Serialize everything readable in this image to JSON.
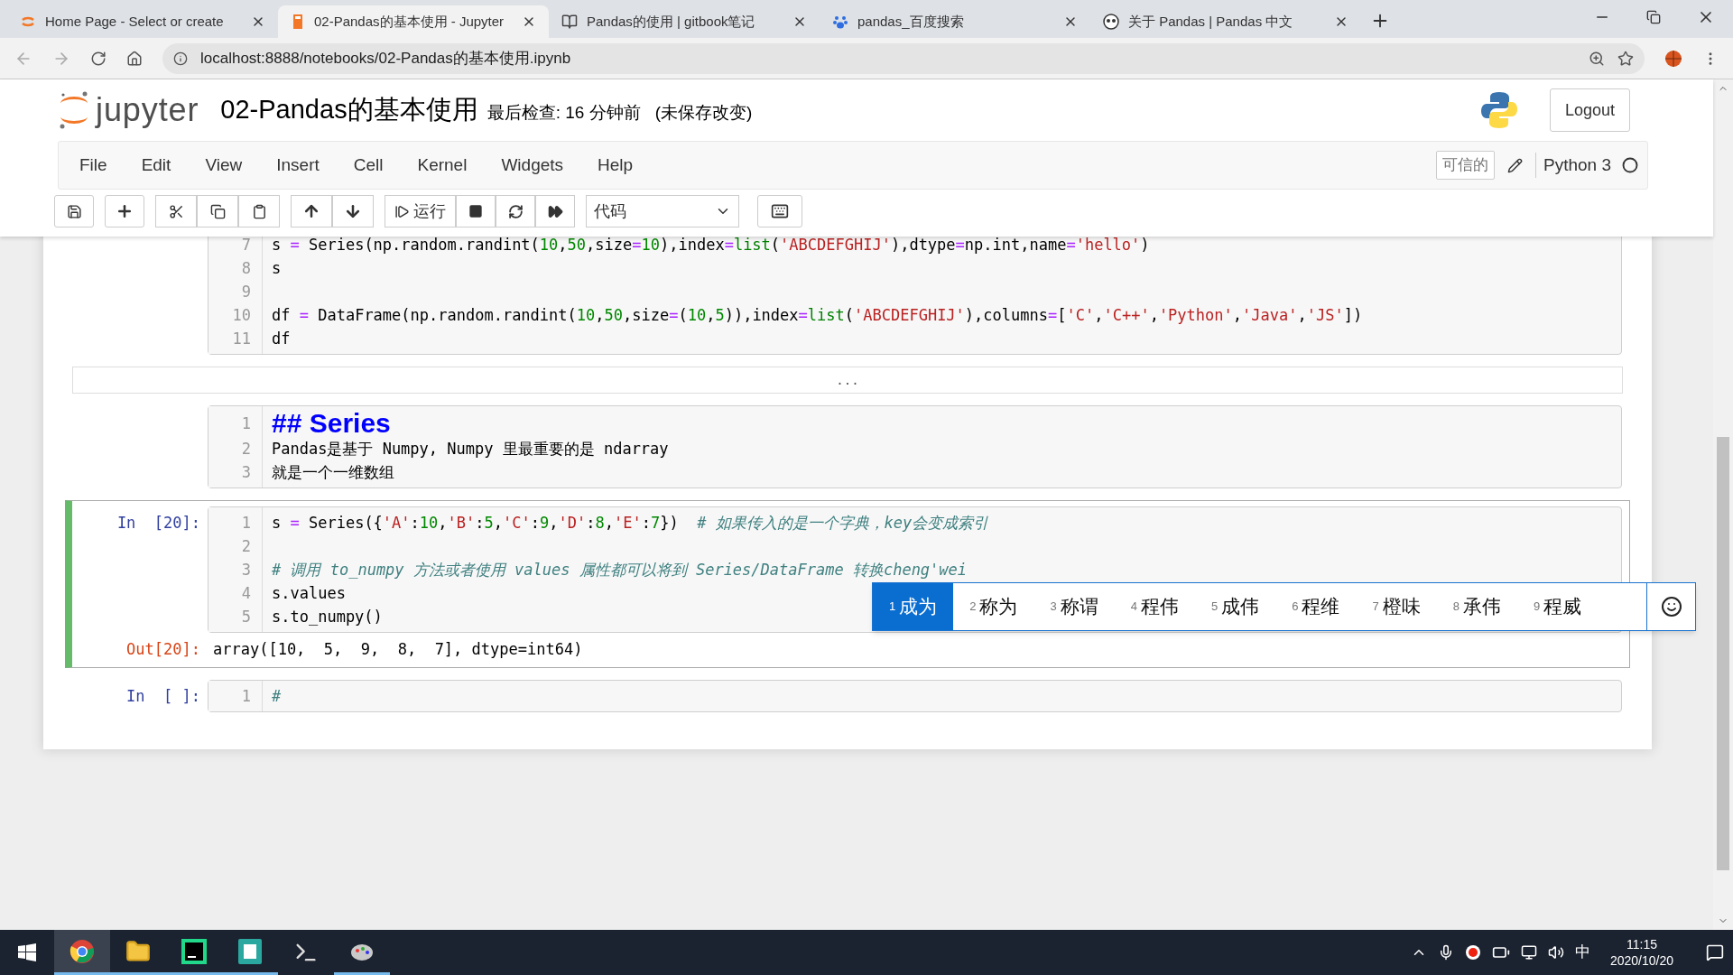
{
  "browser": {
    "tabs": [
      {
        "title": "Home Page - Select or create",
        "selected": false
      },
      {
        "title": "02-Pandas的基本使用 - Jupyter",
        "selected": true
      },
      {
        "title": "Pandas的使用 | gitbook笔记",
        "selected": false
      },
      {
        "title": "pandas_百度搜索",
        "selected": false
      },
      {
        "title": "关于 Pandas | Pandas 中文",
        "selected": false
      }
    ],
    "address": "localhost:8888/notebooks/02-Pandas的基本使用.ipynb"
  },
  "header": {
    "logo_text": "jupyter",
    "title": "02-Pandas的基本使用",
    "checkpoint": "最后检查: 16 分钟前",
    "unsaved": "(未保存改变)",
    "logout": "Logout"
  },
  "menu": [
    "File",
    "Edit",
    "View",
    "Insert",
    "Cell",
    "Kernel",
    "Widgets",
    "Help"
  ],
  "status": {
    "trusted": "可信的",
    "kernel": "Python 3"
  },
  "toolbar": {
    "run": "运行",
    "cell_type": "代码"
  },
  "cells": [
    {
      "kind": "code",
      "selected": false,
      "lines": [
        {
          "number": "7",
          "segments": [
            {
              "text": "s ",
              "kind": "plain"
            },
            {
              "text": "=",
              "kind": "op"
            },
            {
              "text": " Series(np.random.randint(",
              "kind": "plain"
            },
            {
              "text": "10",
              "kind": "number"
            },
            {
              "text": ",",
              "kind": "plain"
            },
            {
              "text": "50",
              "kind": "number"
            },
            {
              "text": ",size",
              "kind": "plain"
            },
            {
              "text": "=",
              "kind": "op"
            },
            {
              "text": "10",
              "kind": "number"
            },
            {
              "text": "),index",
              "kind": "plain"
            },
            {
              "text": "=",
              "kind": "op"
            },
            {
              "text": "list",
              "kind": "builtin"
            },
            {
              "text": "(",
              "kind": "plain"
            },
            {
              "text": "'ABCDEFGHIJ'",
              "kind": "string"
            },
            {
              "text": "),dtype",
              "kind": "plain"
            },
            {
              "text": "=",
              "kind": "op"
            },
            {
              "text": "np.int,name",
              "kind": "plain"
            },
            {
              "text": "=",
              "kind": "op"
            },
            {
              "text": "'hello'",
              "kind": "string"
            },
            {
              "text": ")",
              "kind": "plain"
            }
          ]
        },
        {
          "number": "8",
          "segments": [
            {
              "text": "s",
              "kind": "plain"
            }
          ]
        },
        {
          "number": "9"
        },
        {
          "number": "10",
          "segments": [
            {
              "text": "df ",
              "kind": "plain"
            },
            {
              "text": "=",
              "kind": "op"
            },
            {
              "text": " DataFrame(np.random.randint(",
              "kind": "plain"
            },
            {
              "text": "10",
              "kind": "number"
            },
            {
              "text": ",",
              "kind": "plain"
            },
            {
              "text": "50",
              "kind": "number"
            },
            {
              "text": ",size",
              "kind": "plain"
            },
            {
              "text": "=",
              "kind": "op"
            },
            {
              "text": "(",
              "kind": "plain"
            },
            {
              "text": "10",
              "kind": "number"
            },
            {
              "text": ",",
              "kind": "plain"
            },
            {
              "text": "5",
              "kind": "number"
            },
            {
              "text": ")),index",
              "kind": "plain"
            },
            {
              "text": "=",
              "kind": "op"
            },
            {
              "text": "list",
              "kind": "builtin"
            },
            {
              "text": "(",
              "kind": "plain"
            },
            {
              "text": "'ABCDEFGHIJ'",
              "kind": "string"
            },
            {
              "text": "),columns",
              "kind": "plain"
            },
            {
              "text": "=",
              "kind": "op"
            },
            {
              "text": "[",
              "kind": "plain"
            },
            {
              "text": "'C'",
              "kind": "string"
            },
            {
              "text": ",",
              "kind": "plain"
            },
            {
              "text": "'C++'",
              "kind": "string"
            },
            {
              "text": ",",
              "kind": "plain"
            },
            {
              "text": "'Python'",
              "kind": "string"
            },
            {
              "text": ",",
              "kind": "plain"
            },
            {
              "text": "'Java'",
              "kind": "string"
            },
            {
              "text": ",",
              "kind": "plain"
            },
            {
              "text": "'JS'",
              "kind": "string"
            },
            {
              "text": "])",
              "kind": "plain"
            }
          ]
        },
        {
          "number": "11",
          "segments": [
            {
              "text": "df",
              "kind": "plain"
            }
          ]
        }
      ]
    },
    {
      "kind": "collapsed",
      "text": "..."
    },
    {
      "kind": "markdown",
      "selected": false,
      "lines": [
        {
          "number": "1",
          "segments": [
            {
              "text": "## Series",
              "kind": "heading"
            }
          ]
        },
        {
          "number": "2",
          "segments": [
            {
              "text": "Pandas是基于 Numpy, Numpy 里最重要的是 ndarray",
              "kind": "plain"
            }
          ]
        },
        {
          "number": "3",
          "segments": [
            {
              "text": "就是一个一维数组",
              "kind": "plain"
            }
          ]
        }
      ]
    },
    {
      "kind": "code",
      "selected": true,
      "prompt": "In  [20]:",
      "lines": [
        {
          "number": "1",
          "segments": [
            {
              "text": "s ",
              "kind": "plain"
            },
            {
              "text": "=",
              "kind": "op"
            },
            {
              "text": " Series({",
              "kind": "plain"
            },
            {
              "text": "'A'",
              "kind": "string"
            },
            {
              "text": ":",
              "kind": "plain"
            },
            {
              "text": "10",
              "kind": "number"
            },
            {
              "text": ",",
              "kind": "plain"
            },
            {
              "text": "'B'",
              "kind": "string"
            },
            {
              "text": ":",
              "kind": "plain"
            },
            {
              "text": "5",
              "kind": "number"
            },
            {
              "text": ",",
              "kind": "plain"
            },
            {
              "text": "'C'",
              "kind": "string"
            },
            {
              "text": ":",
              "kind": "plain"
            },
            {
              "text": "9",
              "kind": "number"
            },
            {
              "text": ",",
              "kind": "plain"
            },
            {
              "text": "'D'",
              "kind": "string"
            },
            {
              "text": ":",
              "kind": "plain"
            },
            {
              "text": "8",
              "kind": "number"
            },
            {
              "text": ",",
              "kind": "plain"
            },
            {
              "text": "'E'",
              "kind": "string"
            },
            {
              "text": ":",
              "kind": "plain"
            },
            {
              "text": "7",
              "kind": "number"
            },
            {
              "text": "})  ",
              "kind": "plain"
            },
            {
              "text": "# 如果传入的是一个字典，key会变成索引",
              "kind": "comment"
            }
          ]
        },
        {
          "number": "2"
        },
        {
          "number": "3",
          "segments": [
            {
              "text": "# 调用 to_numpy 方法或者使用 values 属性都可以将到 Series/DataFrame 转换cheng'wei",
              "kind": "comment"
            }
          ]
        },
        {
          "number": "4",
          "segments": [
            {
              "text": "s.values",
              "kind": "plain"
            }
          ]
        },
        {
          "number": "5",
          "segments": [
            {
              "text": "s.to_numpy()",
              "kind": "plain"
            }
          ]
        }
      ],
      "output": {
        "prompt": "Out[20]:",
        "text": "array([10,  5,  9,  8,  7], dtype=int64)"
      }
    },
    {
      "kind": "code",
      "selected": false,
      "prompt": "In  [ ]:",
      "lines": [
        {
          "number": "1",
          "segments": [
            {
              "text": "#",
              "kind": "comment"
            }
          ]
        }
      ]
    }
  ],
  "ime": {
    "candidates": [
      {
        "number": "1",
        "text": "成为",
        "selected": true
      },
      {
        "number": "2",
        "text": "称为",
        "selected": false
      },
      {
        "number": "3",
        "text": "称谓",
        "selected": false
      },
      {
        "number": "4",
        "text": "程伟",
        "selected": false
      },
      {
        "number": "5",
        "text": "成伟",
        "selected": false
      },
      {
        "number": "6",
        "text": "程维",
        "selected": false
      },
      {
        "number": "7",
        "text": "橙味",
        "selected": false
      },
      {
        "number": "8",
        "text": "承伟",
        "selected": false
      },
      {
        "number": "9",
        "text": "程威",
        "selected": false
      }
    ]
  },
  "taskbar": {
    "ime_mode": "中",
    "time": "11:15",
    "date": "2020/10/20"
  }
}
